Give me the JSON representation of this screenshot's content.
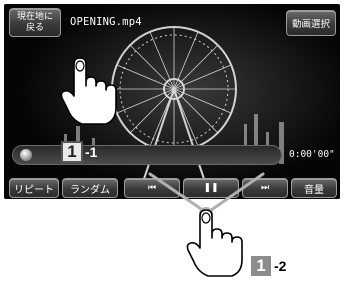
{
  "screen": {
    "back_button_line1": "現在地に",
    "back_button_line2": "戻る",
    "file_name": "OPENING.mp4",
    "select_button": "動画選択",
    "time": "0:00'00\""
  },
  "controls": {
    "repeat": "リピート",
    "random": "ランダム",
    "prev": "⏮",
    "pause": "❚❚",
    "next": "⏭",
    "volume": "音量"
  },
  "playback_progress": 0.0,
  "annotations": {
    "step1_number": "1",
    "step1_suffix": "-1",
    "step2_number": "1",
    "step2_suffix": "-2"
  },
  "icons": [
    "pointing-hand-icon",
    "prev-track-icon",
    "pause-icon",
    "next-track-icon"
  ],
  "colors": {
    "screen_bg": "#050505",
    "button_border": "#9a9a9a",
    "badge_gray": "#8c8c8c",
    "callout_line": "#b0b0b0"
  }
}
